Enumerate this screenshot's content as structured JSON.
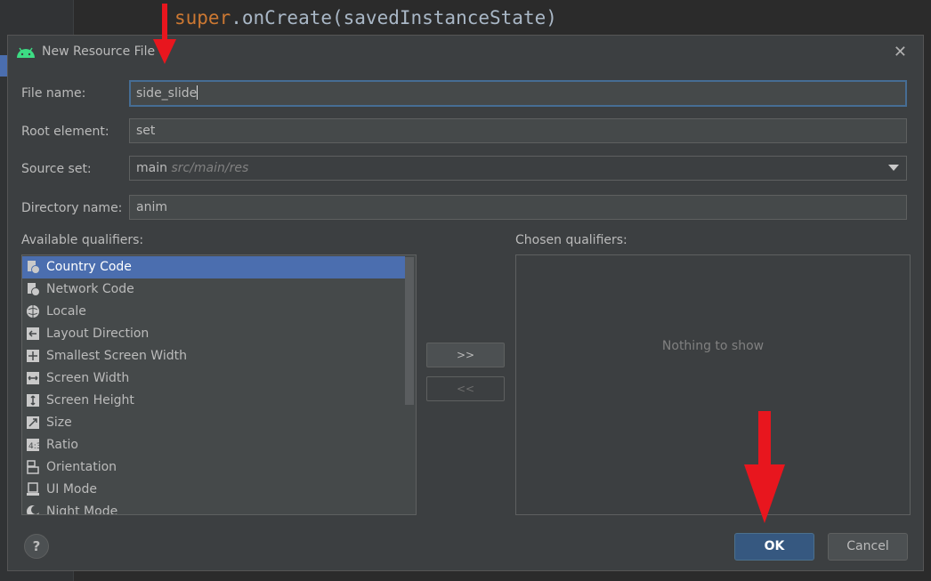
{
  "ide": {
    "code_keyword": "super",
    "code_rest": ".onCreate(savedInstanceState)"
  },
  "dialog": {
    "title": "New Resource File",
    "android_icon": "android-icon",
    "close_icon": "close-icon"
  },
  "form": {
    "file_name_label": "File name:",
    "file_name_value": "side_slide",
    "root_element_label": "Root element:",
    "root_element_value": "set",
    "source_set_label": "Source set:",
    "source_set_value": "main",
    "source_set_path": "src/main/res",
    "directory_name_label": "Directory name:",
    "directory_name_value": "anim"
  },
  "qualifiers": {
    "available_label": "Available qualifiers:",
    "chosen_label": "Chosen qualifiers:",
    "empty_text": "Nothing to show",
    "add_button": ">>",
    "remove_button": "<<",
    "items": [
      {
        "label": "Country Code",
        "icon": "country-code-icon",
        "selected": true
      },
      {
        "label": "Network Code",
        "icon": "network-code-icon"
      },
      {
        "label": "Locale",
        "icon": "globe-icon"
      },
      {
        "label": "Layout Direction",
        "icon": "layout-direction-icon"
      },
      {
        "label": "Smallest Screen Width",
        "icon": "smallest-width-icon"
      },
      {
        "label": "Screen Width",
        "icon": "screen-width-icon"
      },
      {
        "label": "Screen Height",
        "icon": "screen-height-icon"
      },
      {
        "label": "Size",
        "icon": "size-icon"
      },
      {
        "label": "Ratio",
        "icon": "ratio-icon"
      },
      {
        "label": "Orientation",
        "icon": "orientation-icon"
      },
      {
        "label": "UI Mode",
        "icon": "ui-mode-icon"
      },
      {
        "label": "Night Mode",
        "icon": "night-mode-icon"
      }
    ]
  },
  "footer": {
    "help_label": "?",
    "ok_label": "OK",
    "cancel_label": "Cancel"
  },
  "colors": {
    "dialog_bg": "#3c3f41",
    "selection": "#4b6eaf",
    "ok_button": "#365880",
    "annotation_arrow": "#e8161e"
  }
}
